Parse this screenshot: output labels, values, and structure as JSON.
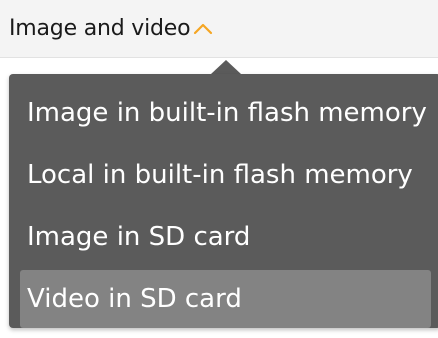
{
  "header": {
    "title": "Image and video",
    "chevron_icon": "chevron-up-icon",
    "accent_color": "#f5a623"
  },
  "menu": {
    "items": [
      {
        "label": "Image in built-in flash memory",
        "selected": false
      },
      {
        "label": "Local in built-in flash memory",
        "selected": false
      },
      {
        "label": "Image in SD card",
        "selected": false
      },
      {
        "label": "Video in SD card",
        "selected": true
      }
    ],
    "background_color": "#5b5b5b",
    "selected_color": "#838383"
  }
}
